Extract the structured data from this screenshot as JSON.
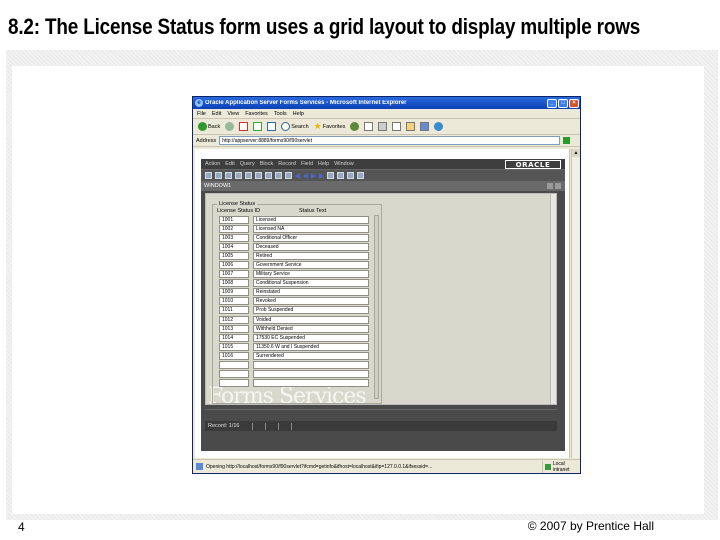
{
  "slide": {
    "title": "8.2: The License Status form uses a grid layout to display multiple rows",
    "page_number": "4",
    "copyright": "© 2007 by Prentice Hall"
  },
  "browser": {
    "window_title": "Oracle Application Server Forms Services - Microsoft Internet Explorer",
    "menu": [
      "File",
      "Edit",
      "View",
      "Favorites",
      "Tools",
      "Help"
    ],
    "toolbar": {
      "back_label": "Back",
      "search_label": "Search",
      "favorites_label": "Favorites"
    },
    "address": {
      "label": "Address",
      "value": "http://appserver:8889/forms90/f90servlet"
    },
    "status_text": "Opening http://localhost/forms90/f90servlet?ifcmd=getinfo&ifhost=localhost&ifip=127.0.0.1&ifsessid=...",
    "zone_label": "Local intranet"
  },
  "forms": {
    "menu": [
      "Action",
      "Edit",
      "Query",
      "Block",
      "Record",
      "Field",
      "Help",
      "Window"
    ],
    "logo": "ORACLE",
    "window_title": "WINDOW1",
    "block_title": "License Status",
    "col_id": "License Status ID",
    "col_text": "Status Text",
    "rows": [
      {
        "id": "1001",
        "text": "Licensed"
      },
      {
        "id": "1002",
        "text": "Licensed NA"
      },
      {
        "id": "1003",
        "text": "Conditional Officer"
      },
      {
        "id": "1004",
        "text": "Deceased"
      },
      {
        "id": "1005",
        "text": "Retired"
      },
      {
        "id": "1006",
        "text": "Government Service"
      },
      {
        "id": "1007",
        "text": "Military Service"
      },
      {
        "id": "1008",
        "text": "Conditional Suspension"
      },
      {
        "id": "1009",
        "text": "Reinstated"
      },
      {
        "id": "1010",
        "text": "Revoked"
      },
      {
        "id": "1011",
        "text": "Prob Suspended"
      },
      {
        "id": "1012",
        "text": "Voided"
      },
      {
        "id": "1013",
        "text": "Withheld Denied"
      },
      {
        "id": "1014",
        "text": "17530 EC Suspended"
      },
      {
        "id": "1015",
        "text": "11350.6 W and I Suspended"
      },
      {
        "id": "1016",
        "text": "Surrendered"
      },
      {
        "id": "",
        "text": ""
      },
      {
        "id": "",
        "text": ""
      },
      {
        "id": "",
        "text": ""
      }
    ],
    "watermark": "Forms Services",
    "record_status": "Record: 1/16"
  },
  "colors": {
    "titlebar": "#0a3fb8",
    "applet_bg": "#4a4a4a",
    "form_bg": "#d8d8cc"
  }
}
